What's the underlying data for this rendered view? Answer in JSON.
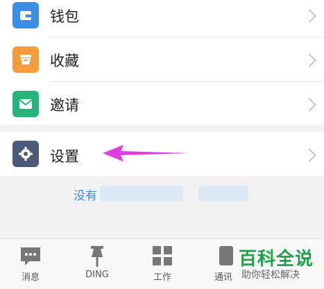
{
  "menu": {
    "items": [
      {
        "label": "钱包",
        "icon": "wallet-icon",
        "color": "#3a8ee6"
      },
      {
        "label": "收藏",
        "icon": "favorites-icon",
        "color": "#f39c3c"
      },
      {
        "label": "邀请",
        "icon": "mail-icon",
        "color": "#27b47a"
      },
      {
        "label": "设置",
        "icon": "gear-icon",
        "color": "#4a5a78"
      }
    ]
  },
  "invite": {
    "text": "没有"
  },
  "annotation": {
    "arrow_color": "#e03ce0"
  },
  "tabbar": {
    "tabs": [
      {
        "label": "消息",
        "icon": "chat-icon"
      },
      {
        "label": "DING",
        "icon": "pin-icon"
      },
      {
        "label": "工作",
        "icon": "grid-icon"
      },
      {
        "label": "通讯",
        "icon": "contacts-icon"
      }
    ]
  },
  "watermark": {
    "title": "百科全说",
    "subtitle": "助你轻松解决",
    "color": "#20a048"
  }
}
